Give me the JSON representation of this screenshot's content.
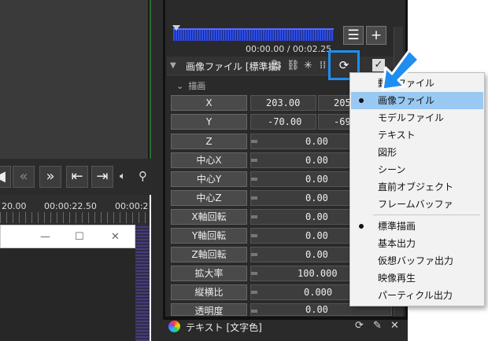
{
  "timeline": {
    "timecode_1": "20.00",
    "timecode_2": "00:00:22.50",
    "timecode_3": "00:00:2",
    "window_buttons": [
      "—",
      "☐",
      "✕"
    ]
  },
  "audio": {
    "time_readout": "00:00.00 / 00:02.25"
  },
  "object": {
    "title": "画像ファイル [標準描画]"
  },
  "section": {
    "label": "描画"
  },
  "params": [
    {
      "label": "X",
      "value_a": "203.00",
      "value_b": "205"
    },
    {
      "label": "Y",
      "value_a": "-70.00",
      "value_b": "-69"
    },
    {
      "label": "Z",
      "value": "0.00"
    },
    {
      "label": "中心X",
      "value": "0.00"
    },
    {
      "label": "中心Y",
      "value": "0.00"
    },
    {
      "label": "中心Z",
      "value": "0.00"
    },
    {
      "label": "X軸回転",
      "value": "0.00"
    },
    {
      "label": "Y軸回転",
      "value": "0.00"
    },
    {
      "label": "Z軸回転",
      "value": "0.00"
    },
    {
      "label": "拡大率",
      "value": "100.000"
    },
    {
      "label": "縦横比",
      "value": "0.000"
    },
    {
      "label": "透明度",
      "value": "0.00"
    }
  ],
  "footer": {
    "title": "テキスト [文字色]"
  },
  "menu": {
    "group1": [
      {
        "label": "動画ファイル",
        "checked": false
      },
      {
        "label": "画像ファイル",
        "checked": true
      },
      {
        "label": "モデルファイル",
        "checked": false
      },
      {
        "label": "テキスト",
        "checked": false
      },
      {
        "label": "図形",
        "checked": false
      },
      {
        "label": "シーン",
        "checked": false
      },
      {
        "label": "直前オブジェクト",
        "checked": false
      },
      {
        "label": "フレームバッファ",
        "checked": false
      }
    ],
    "group2": [
      {
        "label": "標準描画",
        "checked": true
      },
      {
        "label": "基本出力",
        "checked": false
      },
      {
        "label": "仮想バッファ出力",
        "checked": false
      },
      {
        "label": "映像再生",
        "checked": false
      },
      {
        "label": "パーティクル出力",
        "checked": false
      }
    ]
  },
  "colors": {
    "highlight_blue": "#1f8ef1",
    "menu_selected": "#99c9f3",
    "audio_wave": "#2f4de0"
  }
}
